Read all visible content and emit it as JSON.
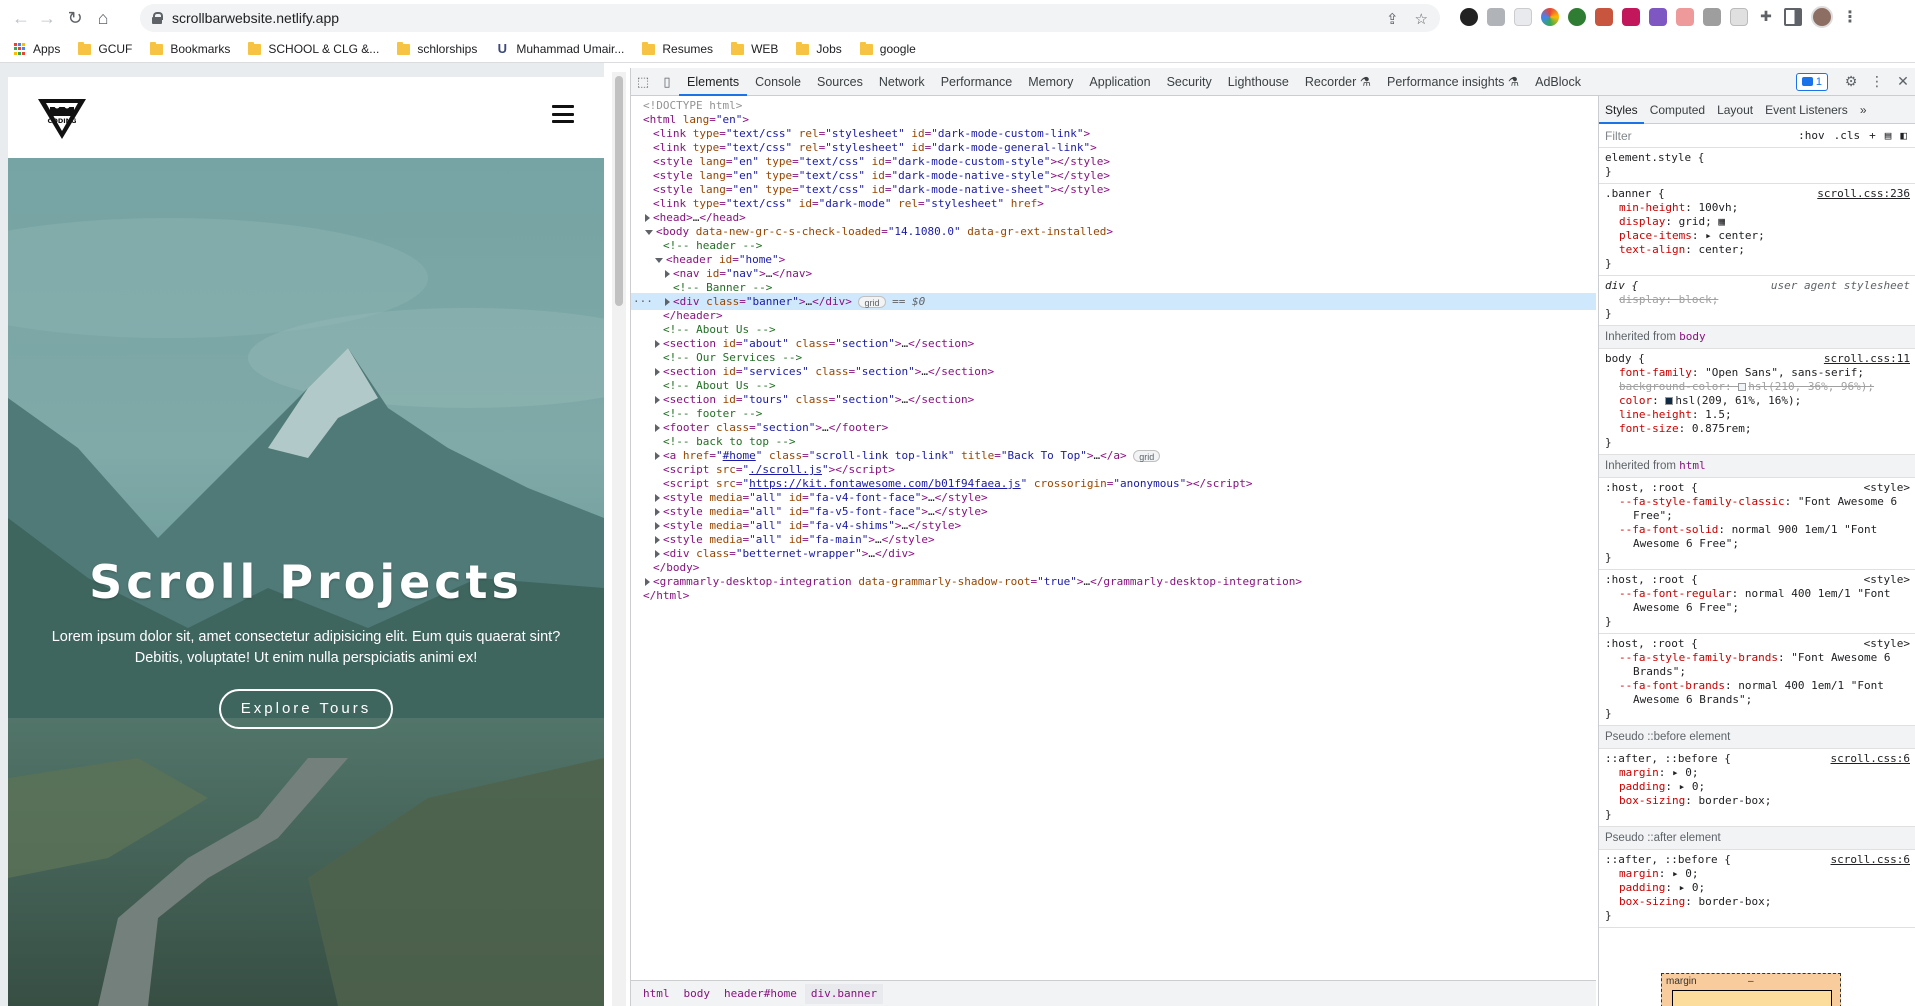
{
  "browser": {
    "url": "scrollbarwebsite.netlify.app",
    "bookmarks": [
      {
        "label": "Apps",
        "icon": "apps-grid-icon"
      },
      {
        "label": "GCUF",
        "icon": "folder-icon"
      },
      {
        "label": "Bookmarks",
        "icon": "folder-icon"
      },
      {
        "label": "SCHOOL & CLG &...",
        "icon": "folder-icon"
      },
      {
        "label": "schlorships",
        "icon": "folder-icon"
      },
      {
        "label": "Muhammad Umair...",
        "icon": "u-icon"
      },
      {
        "label": "Resumes",
        "icon": "folder-icon"
      },
      {
        "label": "WEB",
        "icon": "folder-icon"
      },
      {
        "label": "Jobs",
        "icon": "folder-icon"
      },
      {
        "label": "google",
        "icon": "folder-icon"
      }
    ]
  },
  "site": {
    "logo_text": "CODING",
    "banner_title": "Scroll Projects",
    "banner_text": "Lorem ipsum dolor sit, amet consectetur adipisicing elit. Eum quis quaerat sint? Debitis, voluptate! Ut enim nulla perspiciatis animi ex!",
    "explore_label": "Explore Tours"
  },
  "devtools": {
    "tabs": [
      "Elements",
      "Console",
      "Sources",
      "Network",
      "Performance",
      "Memory",
      "Application",
      "Security",
      "Lighthouse",
      "Recorder",
      "Performance insights",
      "AdBlock"
    ],
    "active_tab": "Elements",
    "message_count": "1",
    "breadcrumbs": [
      "html",
      "body",
      "header#home",
      "div.banner"
    ],
    "styles_tabs": [
      "Styles",
      "Computed",
      "Layout",
      "Event Listeners"
    ],
    "filter_placeholder": "Filter",
    "filter_options": [
      ":hov",
      ".cls"
    ],
    "rules": {
      "element_style": "element.style {",
      "banner_selector": ".banner {",
      "banner_source": "scroll.css:236",
      "div_selector": "div {",
      "div_source": "user agent stylesheet",
      "inherited_body": "Inherited from",
      "body_tag": "body",
      "body_selector": "body {",
      "body_source": "scroll.css:11",
      "inherited_html": "Inherited from",
      "html_tag": "html",
      "host_selector": ":host, :root {",
      "style_source": "<style>",
      "pseudo_before": "Pseudo ::before element",
      "pseudo_after": "Pseudo ::after element",
      "after_before_selector": "::after, ::before {",
      "after_before_source": "scroll.css:6",
      "boxmodel_label": "margin",
      "boxmodel_dash": "–"
    }
  }
}
